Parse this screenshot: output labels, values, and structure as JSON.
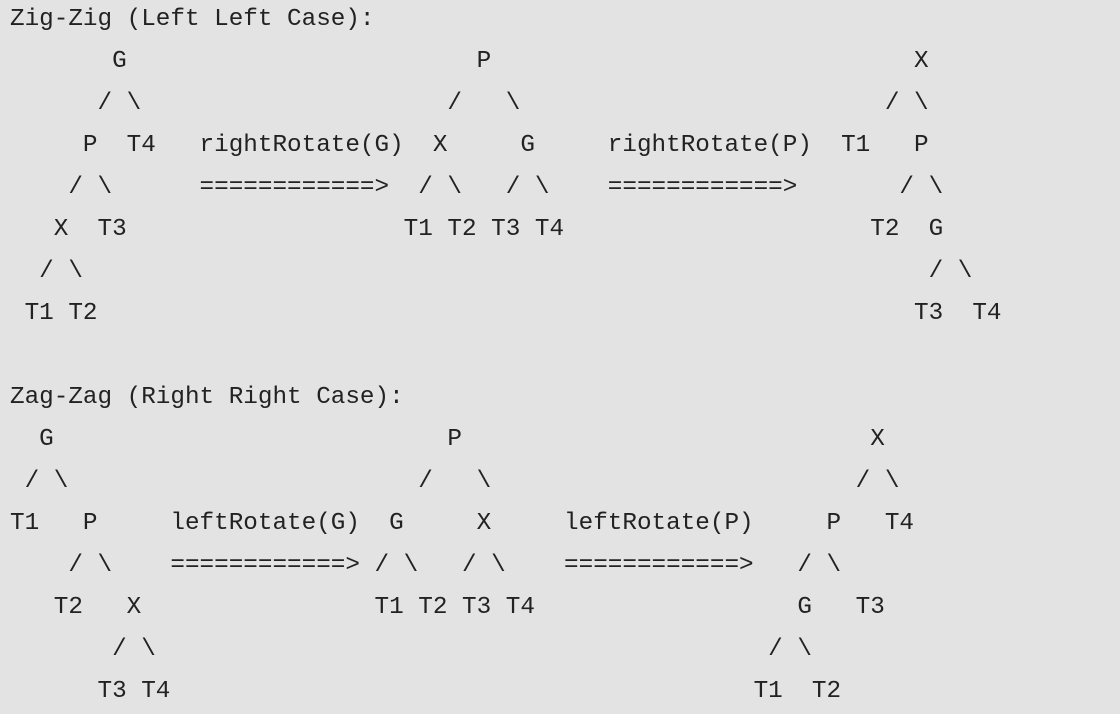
{
  "theme": {
    "background": "#e3e3e3",
    "text_color": "#222222"
  },
  "code_block": {
    "lines": [
      "Zig-Zig (Left Left Case):",
      "       G                        P                             X",
      "      / \\                     /   \\                         / \\",
      "     P  T4   rightRotate(G)  X     G     rightRotate(P)  T1   P",
      "    / \\      ============>  / \\   / \\    ============>       / \\",
      "   X  T3                   T1 T2 T3 T4                     T2  G",
      "  / \\                                                          / \\",
      " T1 T2                                                        T3  T4",
      "",
      "Zag-Zag (Right Right Case):",
      "  G                           P                            X",
      " / \\                        /   \\                         / \\",
      "T1   P     leftRotate(G)  G     X     leftRotate(P)     P   T4",
      "    / \\    ============> / \\   / \\    ============>   / \\",
      "   T2   X                T1 T2 T3 T4                  G   T3",
      "       / \\                                          / \\",
      "      T3 T4                                        T1  T2"
    ]
  }
}
